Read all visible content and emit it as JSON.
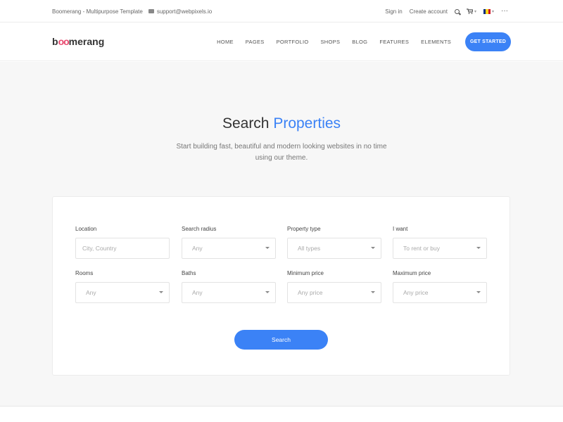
{
  "topbar": {
    "brand_text": "Boomerang - Multipurpose Template",
    "email": "support@webpixels.io",
    "sign_in": "Sign in",
    "create_account": "Create account",
    "cart_icon": "cart-icon",
    "flag_colors": [
      "#002B7F",
      "#FCD116",
      "#CE1126"
    ],
    "more_icon": "···"
  },
  "header": {
    "logo_prefix": "b",
    "logo_oo": "oo",
    "logo_suffix": "merang",
    "nav": [
      "HOME",
      "PAGES",
      "PORTFOLIO",
      "SHOPS",
      "BLOG",
      "FEATURES",
      "ELEMENTS"
    ],
    "cta_label": "GET STARTED"
  },
  "hero": {
    "title_main": "Search ",
    "title_accent": "Properties",
    "subtitle": "Start building fast, beautiful and modern looking websites in no time using our theme."
  },
  "search": {
    "fields": [
      {
        "label": "Location",
        "value": "City, Country",
        "type": "input"
      },
      {
        "label": "Search radius",
        "value": "Any",
        "type": "select"
      },
      {
        "label": "Property type",
        "value": "All types",
        "type": "select"
      },
      {
        "label": "I want",
        "value": "To rent or buy",
        "type": "select"
      },
      {
        "label": "Rooms",
        "value": "Any",
        "type": "select"
      },
      {
        "label": "Baths",
        "value": "Any",
        "type": "select"
      },
      {
        "label": "Minimum price",
        "value": "Any price",
        "type": "select"
      },
      {
        "label": "Maximum price",
        "value": "Any price",
        "type": "select"
      }
    ],
    "button_label": "Search"
  },
  "colors": {
    "accent": "#3b82f6",
    "logo_accent": "#e84a6f"
  }
}
